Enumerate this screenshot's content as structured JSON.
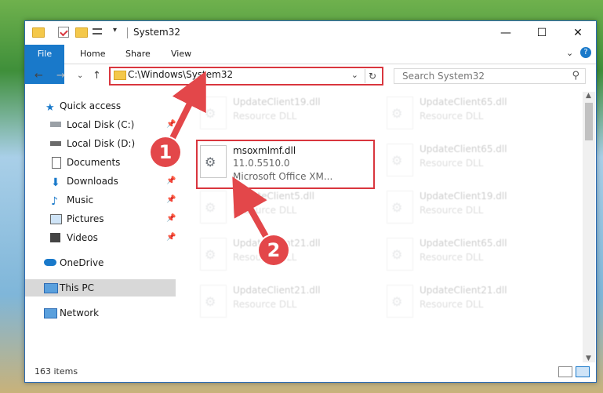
{
  "window": {
    "title": "System32",
    "controls": {
      "minimize": "—",
      "maximize": "☐",
      "close": "✕"
    }
  },
  "ribbon": {
    "tabs": [
      "File",
      "Home",
      "Share",
      "View"
    ],
    "expand_icon": "⌄",
    "help_icon": "?"
  },
  "address": {
    "path": "C:\\Windows\\System32",
    "dropdown": "⌄",
    "refresh": "↻"
  },
  "search": {
    "placeholder": "Search System32",
    "icon": "⚲"
  },
  "nav": {
    "back": "←",
    "forward": "→",
    "recent": "⌄",
    "up": "↑"
  },
  "sidebar": {
    "items": [
      {
        "label": "Quick access"
      },
      {
        "label": "Local Disk (C:)"
      },
      {
        "label": "Local Disk (D:)"
      },
      {
        "label": "Documents"
      },
      {
        "label": "Downloads"
      },
      {
        "label": "Music"
      },
      {
        "label": "Pictures"
      },
      {
        "label": "Videos"
      },
      {
        "label": "OneDrive"
      },
      {
        "label": "This PC"
      },
      {
        "label": "Network"
      }
    ]
  },
  "files": {
    "selected": {
      "name": "msoxmlmf.dll",
      "version": "11.0.5510.0",
      "description": "Microsoft Office XM..."
    },
    "faded": [
      {
        "name": "UpdateClient19.dll",
        "type": "Resource DLL"
      },
      {
        "name": "UpdateClient65.dll",
        "type": "Resource DLL"
      },
      {
        "name": "UpdateClient65.dll",
        "type": "Resource DLL"
      },
      {
        "name": "UpdateClient5.dll",
        "type": "Resource DLL"
      },
      {
        "name": "UpdateClient19.dll",
        "type": "Resource DLL"
      },
      {
        "name": "UpdateClient21.dll",
        "type": "Resource DLL"
      },
      {
        "name": "UpdateClient65.dll",
        "type": "Resource DLL"
      },
      {
        "name": "UpdateClient21.dll",
        "type": "Resource DLL"
      },
      {
        "name": "UpdateClient21.dll",
        "type": "Resource DLL"
      }
    ]
  },
  "status": {
    "count": "163 items"
  },
  "annotations": {
    "step1": "1",
    "step2": "2"
  },
  "colors": {
    "accent": "#1979ca",
    "highlight": "#d9363e",
    "badge": "#e3474a"
  }
}
